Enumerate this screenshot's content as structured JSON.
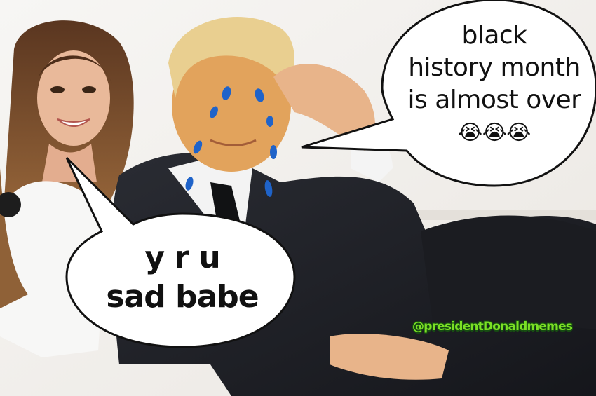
{
  "meme": {
    "speech_right": {
      "lines": [
        "black",
        "history month",
        "is almost over"
      ],
      "emoji": "😭😭😭"
    },
    "speech_left": {
      "lines": [
        "y r u",
        "sad babe"
      ]
    },
    "watermark": "@presidentDonaldmemes",
    "colors": {
      "tears": "#1f63c9",
      "watermark_fill": "#7be025",
      "watermark_outline": "#174d12"
    }
  }
}
